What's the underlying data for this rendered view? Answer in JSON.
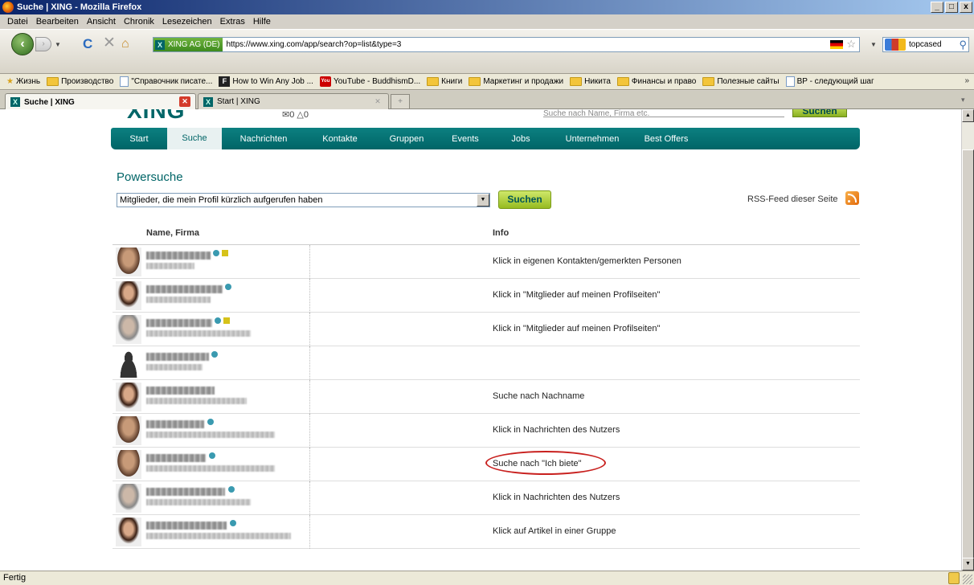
{
  "window": {
    "title": "Suche | XING - Mozilla Firefox",
    "min": "_",
    "max": "□",
    "close": "x"
  },
  "menu": [
    "Datei",
    "Bearbeiten",
    "Ansicht",
    "Chronik",
    "Lesezeichen",
    "Extras",
    "Hilfe"
  ],
  "navbar": {
    "identity_label": "XING AG (DE)",
    "url": "https://www.xing.com/app/search?op=list&type=3",
    "search_value": "topcased"
  },
  "bookmarks": [
    {
      "label": "Жизнь",
      "icon": "star-icon"
    },
    {
      "label": "Производство",
      "icon": "folder-icon"
    },
    {
      "label": "\"Справочник писате...",
      "icon": "page-icon"
    },
    {
      "label": "How to Win Any Job ...",
      "icon": "f-icon"
    },
    {
      "label": "YouTube - BuddhismD...",
      "icon": "youtube-icon"
    },
    {
      "label": "Книги",
      "icon": "folder-icon"
    },
    {
      "label": "Маркетинг и продажи",
      "icon": "folder-icon"
    },
    {
      "label": "Никита",
      "icon": "folder-icon"
    },
    {
      "label": "Финансы и право",
      "icon": "folder-icon"
    },
    {
      "label": "Полезные сайты",
      "icon": "folder-icon"
    },
    {
      "label": "BP - следующий шаг",
      "icon": "page-icon"
    }
  ],
  "tabs": [
    {
      "label": "Suche | XING",
      "active": true
    },
    {
      "label": "Start | XING",
      "active": false
    }
  ],
  "xing": {
    "logo": "XING",
    "counts": "✉0 △0",
    "top_search_placeholder": "Suche nach Name, Firma etc.",
    "top_search_button": "Suchen",
    "nav": [
      "Start",
      "Suche",
      "Nachrichten",
      "Kontakte",
      "Gruppen",
      "Events",
      "Jobs",
      "Unternehmen",
      "Best Offers"
    ],
    "nav_active": "Suche",
    "page_title": "Powersuche",
    "select_value": "Mitglieder, die mein Profil kürzlich aufgerufen haben",
    "search_button": "Suchen",
    "rss_label": "RSS-Feed dieser Seite",
    "col_name": "Name, Firma",
    "col_info": "Info",
    "rows": [
      {
        "info": "Klick in eigenen Kontakten/gemerkten Personen",
        "avatar": "man",
        "premium": true
      },
      {
        "info": "Klick in \"Mitglieder auf meinen Profilseiten\"",
        "avatar": "hair",
        "premium": false
      },
      {
        "info": "Klick in \"Mitglieder auf meinen Profilseiten\"",
        "avatar": "grey",
        "premium": true
      },
      {
        "info": "",
        "avatar": "dark",
        "premium": false
      },
      {
        "info": "Suche nach Nachname",
        "avatar": "hair",
        "premium": false
      },
      {
        "info": "Klick in Nachrichten des Nutzers",
        "avatar": "man",
        "premium": false
      },
      {
        "info": "Suche nach \"Ich biete\"",
        "avatar": "man",
        "premium": false,
        "highlighted": true
      },
      {
        "info": "Klick in Nachrichten des Nutzers",
        "avatar": "grey",
        "premium": false
      },
      {
        "info": "Klick auf Artikel in einer Gruppe",
        "avatar": "hair",
        "premium": false
      }
    ]
  },
  "status": "Fertig"
}
